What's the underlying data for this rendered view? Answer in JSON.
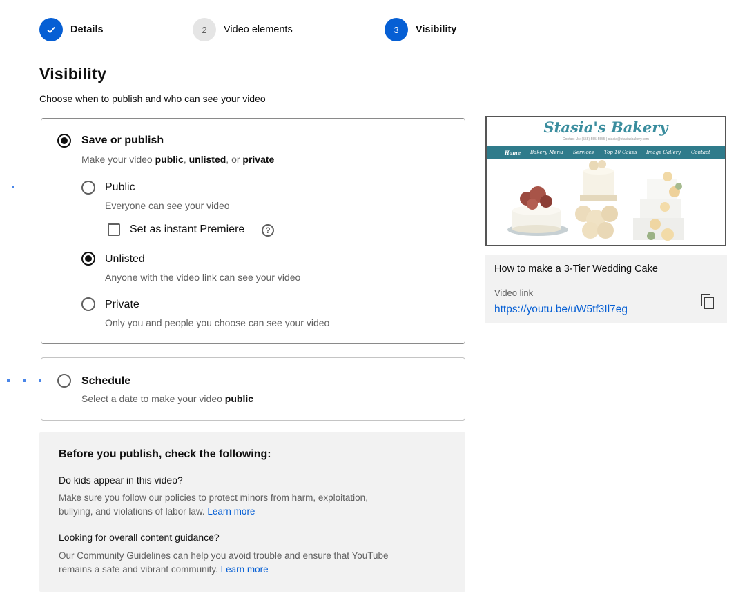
{
  "stepper": {
    "step1": {
      "label": "Details",
      "mark": "check-icon"
    },
    "step2": {
      "number": "2",
      "label": "Video elements"
    },
    "step3": {
      "number": "3",
      "label": "Visibility"
    }
  },
  "heading": "Visibility",
  "subtitle": "Choose when to publish and who can see your video",
  "save_publish": {
    "title": "Save or publish",
    "desc_prefix": "Make your video ",
    "desc_public": "public",
    "desc_sep1": ", ",
    "desc_unlisted": "unlisted",
    "desc_sep2": ", or ",
    "desc_private": "private",
    "selected": true,
    "options": {
      "public": {
        "title": "Public",
        "desc": "Everyone can see your video",
        "selected": false
      },
      "premiere": {
        "label": "Set as instant Premiere",
        "checked": false,
        "help": "?"
      },
      "unlisted": {
        "title": "Unlisted",
        "desc": "Anyone with the video link can see your video",
        "selected": true
      },
      "private": {
        "title": "Private",
        "desc": "Only you and people you choose can see your video",
        "selected": false
      }
    }
  },
  "schedule": {
    "title": "Schedule",
    "desc_prefix": "Select a date to make your video ",
    "desc_bold": "public",
    "selected": false
  },
  "checklist": {
    "heading": "Before you publish, check the following:",
    "q1": "Do kids appear in this video?",
    "p1": "Make sure you follow our policies to protect minors from harm, exploitation, bullying, and violations of labor law.",
    "p1_link": "Learn more",
    "q2": "Looking for overall content guidance?",
    "p2": "Our Community Guidelines can help you avoid trouble and ensure that YouTube remains a safe and vibrant community.",
    "p2_link": "Learn more"
  },
  "preview": {
    "thumbnail": {
      "site_title": "Stasia's Bakery",
      "contact": "Contact Us: (555) 555-5555 | stasia@stasiasbakery.com",
      "nav": [
        "Home",
        "Bakery Menu",
        "Services",
        "Top 10 Cakes",
        "Image Gallery",
        "Contact"
      ]
    },
    "video_title": "How to make a 3-Tier Wedding Cake",
    "link_label": "Video link",
    "link": "https://youtu.be/uW5tf3Il7eg",
    "copy_icon": "copy-icon"
  },
  "colors": {
    "accent": "#065fd4",
    "text": "#0f0f0f",
    "secondary": "#606060",
    "panel": "#f2f2f2"
  }
}
